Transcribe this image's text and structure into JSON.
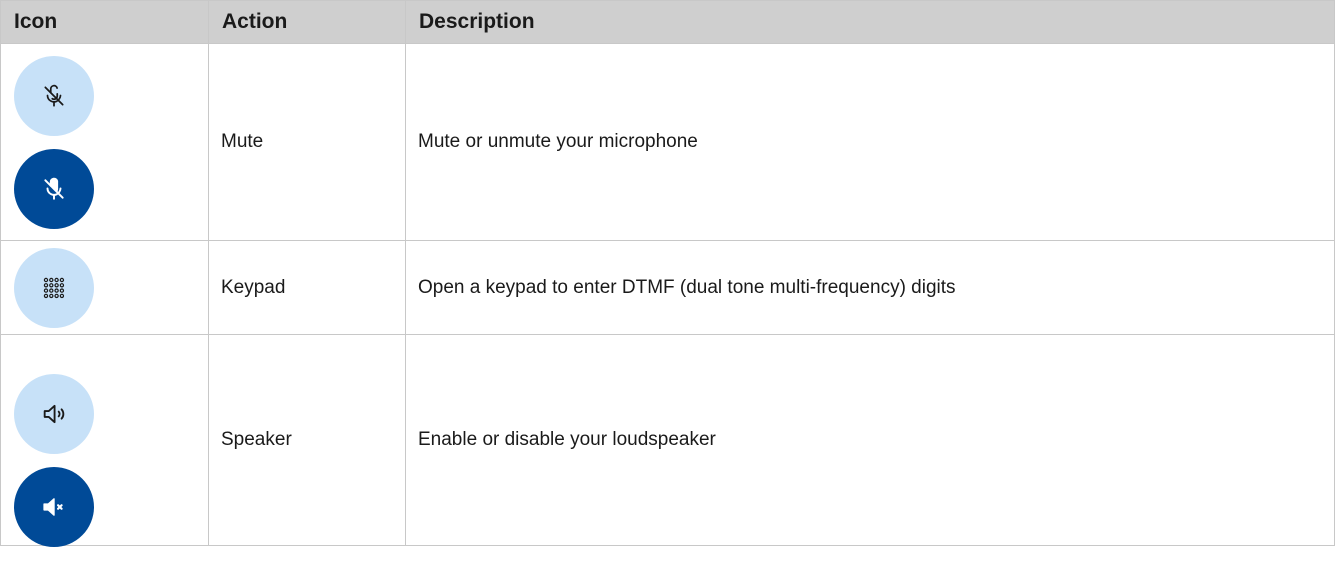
{
  "table": {
    "headers": {
      "icon": "Icon",
      "action": "Action",
      "description": "Description"
    },
    "rows": [
      {
        "action": "Mute",
        "description": "Mute or unmute your microphone",
        "icons": [
          "mic-muted-outline-icon",
          "mic-muted-filled-icon"
        ]
      },
      {
        "action": "Keypad",
        "description": "Open a keypad to enter DTMF (dual tone multi-frequency) digits",
        "icons": [
          "keypad-grid-icon"
        ]
      },
      {
        "action": "Speaker",
        "description": "Enable or disable your loudspeaker",
        "icons": [
          "speaker-outline-icon",
          "speaker-muted-filled-icon"
        ]
      }
    ]
  },
  "colors": {
    "header_background": "#cfcfcf",
    "circle_light": "#c7e1f8",
    "circle_dark": "#004a97",
    "icon_on_light": "#1a1a1a",
    "icon_on_dark": "#ffffff",
    "border": "#c8c8c8"
  }
}
